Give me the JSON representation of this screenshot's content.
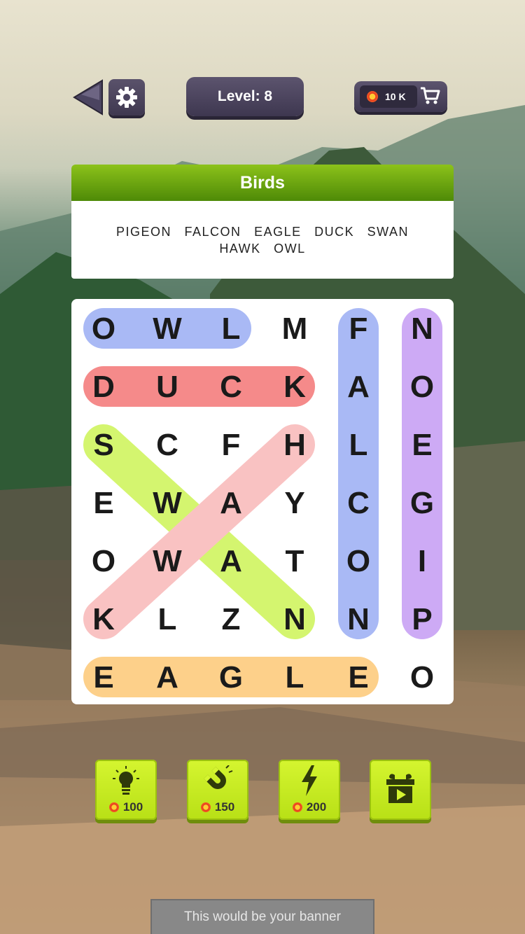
{
  "header": {
    "level_label": "Level: 8",
    "coins_label": "10 K"
  },
  "icons": {
    "back": "back-arrow-icon",
    "settings": "gear-icon",
    "coin": "coin-icon",
    "cart": "cart-icon"
  },
  "category": {
    "title": "Birds",
    "words": [
      "PIGEON",
      "FALCON",
      "EAGLE",
      "DUCK",
      "SWAN",
      "HAWK",
      "OWL"
    ]
  },
  "grid": {
    "rows": [
      [
        "O",
        "W",
        "L",
        "M",
        "F",
        "N"
      ],
      [
        "D",
        "U",
        "C",
        "K",
        "A",
        "O"
      ],
      [
        "S",
        "C",
        "F",
        "H",
        "L",
        "E"
      ],
      [
        "E",
        "W",
        "A",
        "Y",
        "C",
        "G"
      ],
      [
        "O",
        "W",
        "A",
        "T",
        "O",
        "I"
      ],
      [
        "K",
        "L",
        "Z",
        "N",
        "N",
        "P"
      ],
      [
        "E",
        "A",
        "G",
        "L",
        "E",
        "O"
      ]
    ],
    "found": [
      {
        "word": "OWL",
        "from": [
          0,
          0
        ],
        "to": [
          0,
          2
        ],
        "color": "#a9b9f5"
      },
      {
        "word": "DUCK",
        "from": [
          1,
          0
        ],
        "to": [
          1,
          3
        ],
        "color": "#f58a8a"
      },
      {
        "word": "FALCON",
        "from": [
          0,
          4
        ],
        "to": [
          5,
          4
        ],
        "color": "#a9b9f5"
      },
      {
        "word": "PIGEON",
        "from": [
          0,
          5
        ],
        "to": [
          5,
          5
        ],
        "color": "#cdaaf5"
      },
      {
        "word": "SWAN",
        "from": [
          2,
          0
        ],
        "to": [
          5,
          3
        ],
        "color": "#d4f56f"
      },
      {
        "word": "HAWK",
        "from": [
          2,
          3
        ],
        "to": [
          5,
          0
        ],
        "color": "#f9c2c2"
      },
      {
        "word": "EAGLE",
        "from": [
          6,
          0
        ],
        "to": [
          6,
          4
        ],
        "color": "#fdd08a"
      }
    ]
  },
  "powerups": [
    {
      "name": "hint",
      "icon": "lightbulb-icon",
      "cost": "100"
    },
    {
      "name": "magnet",
      "icon": "magnet-icon",
      "cost": "150"
    },
    {
      "name": "lightning",
      "icon": "lightning-icon",
      "cost": "200"
    },
    {
      "name": "free-video",
      "icon": "gift-video-icon",
      "cost": ""
    }
  ],
  "banner": {
    "text": "This would be your banner"
  }
}
